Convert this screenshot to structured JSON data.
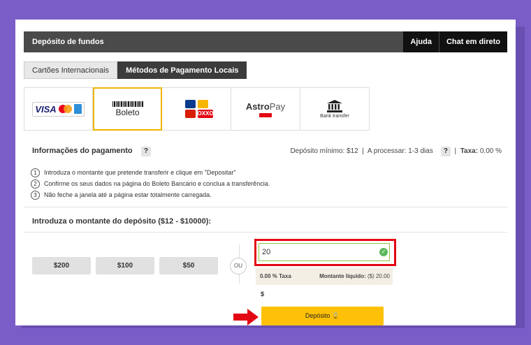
{
  "header": {
    "title": "Depósito de fundos",
    "help_label": "Ajuda",
    "chat_label": "Chat em direto"
  },
  "tabs": [
    {
      "label": "Cartões Internacionais",
      "active": false
    },
    {
      "label": "Métodos de Pagamento Locais",
      "active": true
    }
  ],
  "methods": [
    {
      "name": "visa-mastercard",
      "visa_text": "VISA"
    },
    {
      "name": "boleto",
      "text": "Boleto",
      "selected": true
    },
    {
      "name": "local-banks-oxxo",
      "oxxo_text": "OXXO"
    },
    {
      "name": "astropay",
      "text_a": "Astro",
      "text_b": "Pay"
    },
    {
      "name": "bank-transfer",
      "text": "Bank transfer"
    }
  ],
  "info": {
    "title": "Informações do pagamento",
    "help_icon": "?",
    "min_label": "Depósito mínimo:",
    "min_value": "$12",
    "processing_label": "A processar:",
    "processing_value": "1-3 dias",
    "tax_label": "Taxa:",
    "tax_value": "0.00 %"
  },
  "steps": [
    {
      "n": "1",
      "text": "Introduza o montante que pretende transferir e clique em \"Depositar\""
    },
    {
      "n": "2",
      "text": "Confirme os seus dados na página do Boleto Bancário e conclua a transferência."
    },
    {
      "n": "3",
      "text": "Não feche a janela até a página estar totalmente carregada."
    }
  ],
  "amount": {
    "title": "Introduza o montante do depósito ($12 - $10000):",
    "presets": [
      "$200",
      "$100",
      "$50"
    ],
    "or_label": "OU",
    "input_value": "20",
    "tax_text": "0.00 % Taxa",
    "net_label": "Montante líquido:",
    "net_value": "($) 20.00",
    "currency": "$",
    "deposit_label": "Depósito 🔒"
  },
  "colors": {
    "accent": "#ffc107",
    "highlight": "#e30613",
    "background": "#7b5dc8"
  }
}
